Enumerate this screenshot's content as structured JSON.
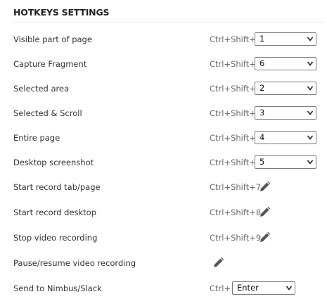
{
  "title": "HOTKEYS SETTINGS",
  "rows": [
    {
      "label": "Visible part of page",
      "prefix": "Ctrl+Shift+",
      "value": "1"
    },
    {
      "label": "Capture Fragment",
      "prefix": "Ctrl+Shift+",
      "value": "6"
    },
    {
      "label": "Selected area",
      "prefix": "Ctrl+Shift+",
      "value": "2"
    },
    {
      "label": "Selected & Scroll",
      "prefix": "Ctrl+Shift+",
      "value": "3"
    },
    {
      "label": "Entire page",
      "prefix": "Ctrl+Shift+",
      "value": "4"
    },
    {
      "label": "Desktop screenshot",
      "prefix": "Ctrl+Shift+",
      "value": "5"
    },
    {
      "label": "Start record tab/page",
      "shortcut": "Ctrl+Shift+7",
      "icon": "pencil-icon"
    },
    {
      "label": "Start record desktop",
      "shortcut": "Ctrl+Shift+8",
      "icon": "pencil-icon"
    },
    {
      "label": "Stop video recording",
      "shortcut": "Ctrl+Shift+9",
      "icon": "pencil-icon"
    },
    {
      "label": "Pause/resume video recording",
      "shortcut": "",
      "icon": "pencil-icon"
    },
    {
      "label": "Send to Nimbus/Slack",
      "prefix": "Ctrl+",
      "value": "Enter"
    }
  ]
}
